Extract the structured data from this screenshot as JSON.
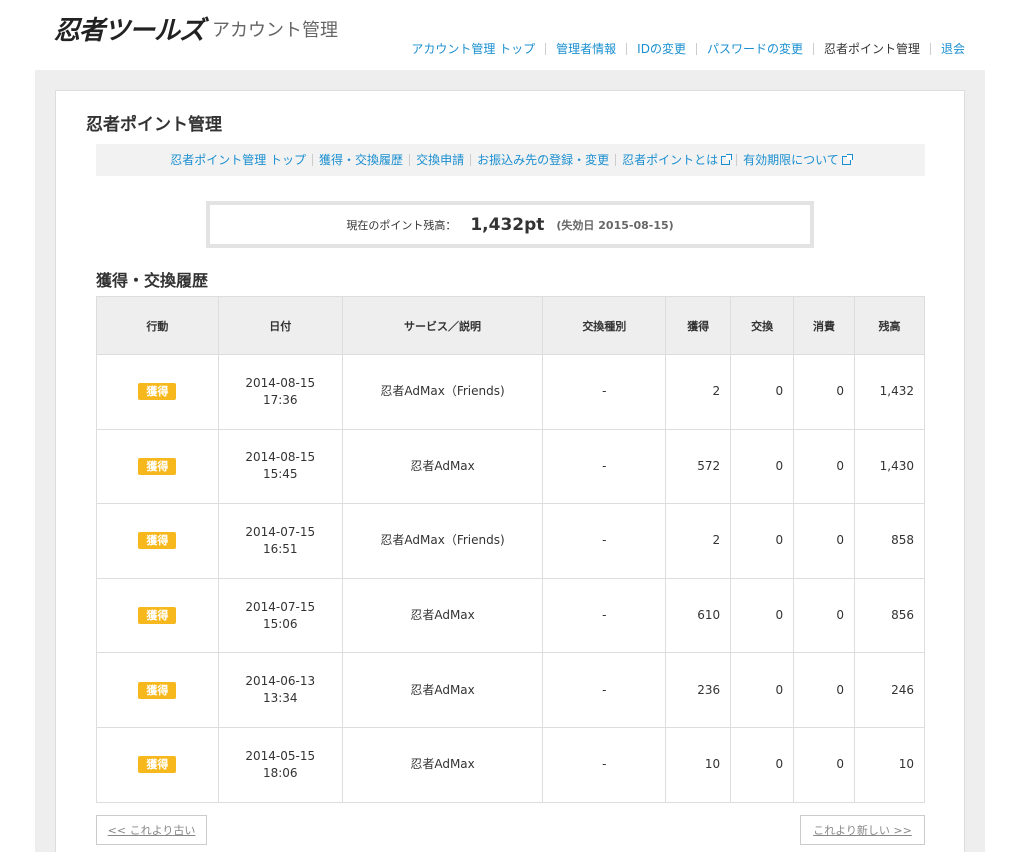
{
  "header": {
    "logo": "忍者ツールズ",
    "subtitle": "アカウント管理",
    "nav": [
      {
        "label": "アカウント管理 トップ",
        "current": false
      },
      {
        "label": "管理者情報",
        "current": false
      },
      {
        "label": "IDの変更",
        "current": false
      },
      {
        "label": "パスワードの変更",
        "current": false
      },
      {
        "label": "忍者ポイント管理",
        "current": true
      },
      {
        "label": "退会",
        "current": false
      }
    ]
  },
  "panel": {
    "title": "忍者ポイント管理",
    "subnav": [
      {
        "label": "忍者ポイント管理 トップ",
        "external": false
      },
      {
        "label": "獲得・交換履歴",
        "external": false
      },
      {
        "label": "交換申請",
        "external": false
      },
      {
        "label": "お振込み先の登録・変更",
        "external": false
      },
      {
        "label": "忍者ポイントとは",
        "external": true
      },
      {
        "label": "有効期限について",
        "external": true
      }
    ],
    "balance": {
      "label": "現在のポイント残高：",
      "points": "1,432pt",
      "expiry": "(失効日 2015-08-15)"
    },
    "section_title": "獲得・交換履歴",
    "table": {
      "headers": [
        "行動",
        "日付",
        "サービス／説明",
        "交換種別",
        "獲得",
        "交換",
        "消費",
        "残高"
      ],
      "rows": [
        {
          "action": "獲得",
          "date": "2014-08-15",
          "time": "17:36",
          "service": "忍者AdMax（Friends)",
          "type": "-",
          "earned": "2",
          "exchanged": "0",
          "consumed": "0",
          "balance": "1,432"
        },
        {
          "action": "獲得",
          "date": "2014-08-15",
          "time": "15:45",
          "service": "忍者AdMax",
          "type": "-",
          "earned": "572",
          "exchanged": "0",
          "consumed": "0",
          "balance": "1,430"
        },
        {
          "action": "獲得",
          "date": "2014-07-15",
          "time": "16:51",
          "service": "忍者AdMax（Friends)",
          "type": "-",
          "earned": "2",
          "exchanged": "0",
          "consumed": "0",
          "balance": "858"
        },
        {
          "action": "獲得",
          "date": "2014-07-15",
          "time": "15:06",
          "service": "忍者AdMax",
          "type": "-",
          "earned": "610",
          "exchanged": "0",
          "consumed": "0",
          "balance": "856"
        },
        {
          "action": "獲得",
          "date": "2014-06-13",
          "time": "13:34",
          "service": "忍者AdMax",
          "type": "-",
          "earned": "236",
          "exchanged": "0",
          "consumed": "0",
          "balance": "246"
        },
        {
          "action": "獲得",
          "date": "2014-05-15",
          "time": "18:06",
          "service": "忍者AdMax",
          "type": "-",
          "earned": "10",
          "exchanged": "0",
          "consumed": "0",
          "balance": "10"
        }
      ]
    },
    "pager": {
      "prev": "<< これより古い",
      "next": "これより新しい >>"
    }
  },
  "colors": {
    "link": "#1a8fd0",
    "badge": "#f7b81e",
    "outer_bg": "#eeeeee"
  }
}
